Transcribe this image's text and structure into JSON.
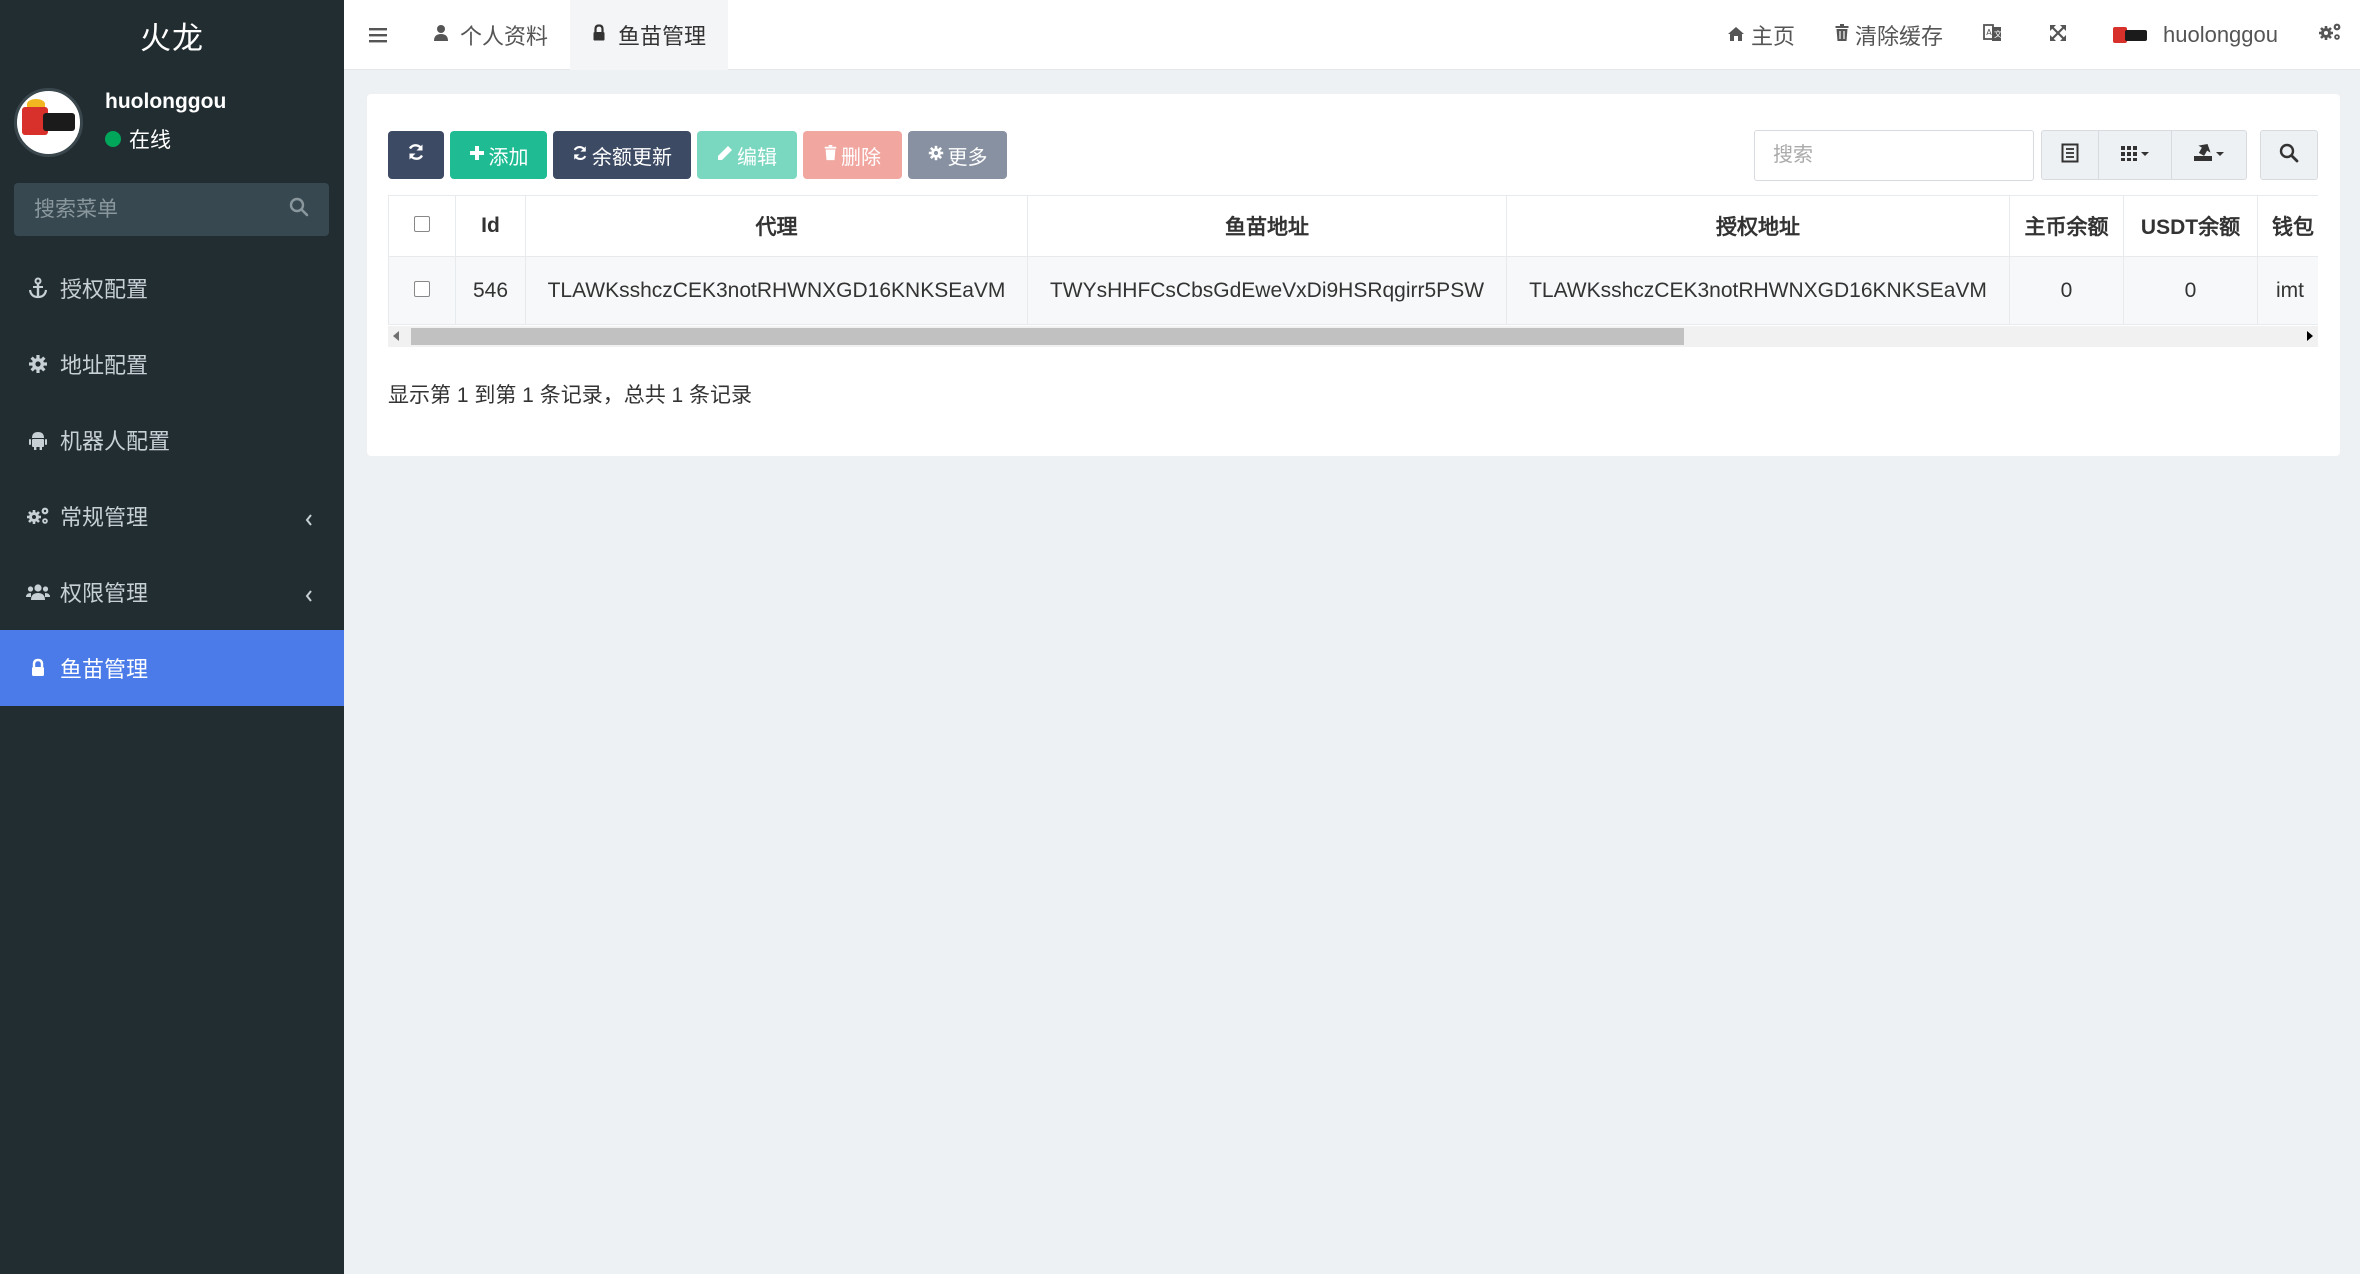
{
  "sidebar": {
    "logo": "火龙",
    "user": {
      "name": "huolonggou",
      "status": "在线"
    },
    "search_placeholder": "搜索菜单",
    "items": [
      {
        "label": "授权配置",
        "icon": "anchor-icon"
      },
      {
        "label": "地址配置",
        "icon": "gear-icon"
      },
      {
        "label": "机器人配置",
        "icon": "android-icon"
      },
      {
        "label": "常规管理",
        "icon": "gears-icon",
        "expandable": true
      },
      {
        "label": "权限管理",
        "icon": "users-icon",
        "expandable": true
      },
      {
        "label": "鱼苗管理",
        "icon": "lock-icon",
        "active": true
      }
    ]
  },
  "topbar": {
    "tabs": [
      {
        "label": "个人资料",
        "icon": "user-icon"
      },
      {
        "label": "鱼苗管理",
        "icon": "lock-icon",
        "active": true
      }
    ],
    "home": "主页",
    "clear_cache": "清除缓存",
    "username": "huolonggou"
  },
  "toolbar": {
    "add": "添加",
    "balance_update": "余额更新",
    "edit": "编辑",
    "delete": "删除",
    "more": "更多",
    "search_placeholder": "搜索"
  },
  "table": {
    "columns": [
      "Id",
      "代理",
      "鱼苗地址",
      "授权地址",
      "主币余额",
      "USDT余额",
      "钱包"
    ],
    "rows": [
      {
        "id": "546",
        "agent": "TLAWKsshczCEK3notRHWNXGD16KNKSEaVM",
        "fish_address": "TWYsHHFCsCbsGdEweVxDi9HSRqgirr5PSW",
        "auth_address": "TLAWKsshczCEK3notRHWNXGD16KNKSEaVM",
        "main_balance": "0",
        "usdt_balance": "0",
        "wallet": "imt"
      }
    ]
  },
  "pagination_info": "显示第 1 到第 1 条记录，总共 1 条记录",
  "colors": {
    "sidebar_bg": "#222d32",
    "active_menu": "#4a7be8",
    "btn_dark": "#3c4a64",
    "btn_add": "#1fbc94",
    "btn_edit": "#7bd8c0",
    "btn_delete": "#f1a6a0",
    "btn_more": "#8791a1"
  }
}
